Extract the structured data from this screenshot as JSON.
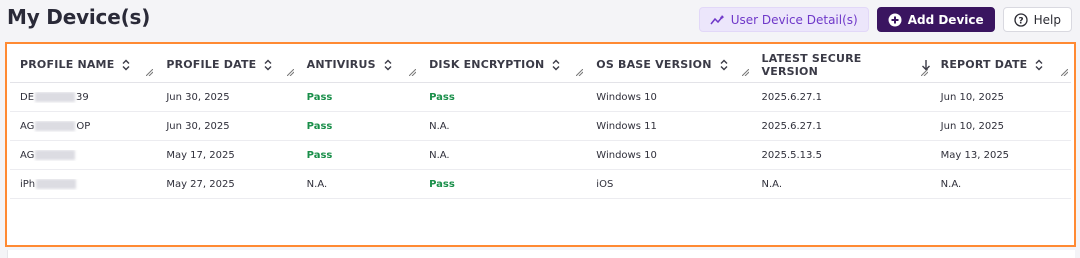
{
  "page": {
    "title": "My Device(s)"
  },
  "toolbar": {
    "detail_label": "User Device Detail(s)",
    "add_label": "Add Device",
    "help_label": "Help"
  },
  "table": {
    "columns": [
      {
        "label": "PROFILE NAME",
        "sort": "both"
      },
      {
        "label": "PROFILE DATE",
        "sort": "both"
      },
      {
        "label": "ANTIVIRUS",
        "sort": "both"
      },
      {
        "label": "DISK ENCRYPTION",
        "sort": "both"
      },
      {
        "label": "OS BASE VERSION",
        "sort": "both"
      },
      {
        "label": "LATEST SECURE VERSION",
        "sort": "desc"
      },
      {
        "label": "REPORT DATE",
        "sort": "both"
      }
    ],
    "rows": [
      {
        "name_prefix": "DE",
        "name_suffix": "39",
        "profile_date": "Jun 30, 2025",
        "antivirus": "Pass",
        "disk": "Pass",
        "os": "Windows 10",
        "secure": "2025.6.27.1",
        "report": "Jun 10, 2025"
      },
      {
        "name_prefix": "AG",
        "name_suffix": "OP",
        "profile_date": "Jun 30, 2025",
        "antivirus": "Pass",
        "disk": "N.A.",
        "os": "Windows 11",
        "secure": "2025.6.27.1",
        "report": "Jun 10, 2025"
      },
      {
        "name_prefix": "AG",
        "name_suffix": "",
        "profile_date": "May 17, 2025",
        "antivirus": "Pass",
        "disk": "N.A.",
        "os": "Windows 10",
        "secure": "2025.5.13.5",
        "report": "May 13, 2025"
      },
      {
        "name_prefix": "iPh",
        "name_suffix": "",
        "profile_date": "May 27, 2025",
        "antivirus": "N.A.",
        "disk": "Pass",
        "os": "iOS",
        "secure": "N.A.",
        "report": "N.A."
      }
    ]
  },
  "colors": {
    "pass": "#1a8f4a",
    "accent": "#3a1560",
    "highlight_border": "#ff8a33"
  }
}
